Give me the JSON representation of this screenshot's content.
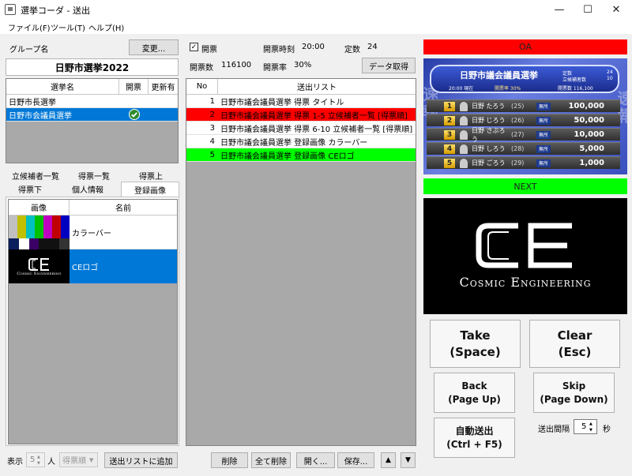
{
  "window": {
    "title": "選挙コーダ - 送出",
    "minimize": "—",
    "maximize": "☐",
    "close": "✕"
  },
  "menu": [
    "ファイル(F)",
    "ツール(T)",
    "ヘルプ(H)"
  ],
  "left": {
    "group_label": "グループ名",
    "change_button": "変更...",
    "group_name": "日野市選挙2022",
    "election_table": {
      "headers": [
        "選挙名",
        "開票",
        "更新有"
      ],
      "rows": [
        {
          "name": "日野市長選挙",
          "checked": false
        },
        {
          "name": "日野市会議員選挙",
          "checked": true
        }
      ]
    },
    "tabs_row1": [
      "立候補者一覧",
      "得票一覧",
      "得票上"
    ],
    "tabs_row2": [
      "得票下",
      "個人情報",
      "登録画像"
    ],
    "image_table": {
      "headers": [
        "画像",
        "名前"
      ],
      "rows": [
        {
          "name": "カラーバー"
        },
        {
          "name": "CEロゴ"
        }
      ]
    },
    "display_label": "表示",
    "display_count": "5",
    "person_unit": "人",
    "sort_select": "得票順",
    "add_button": "送出リストに追加"
  },
  "middle": {
    "open_checkbox_label": "開票",
    "open_time_label": "開票時刻",
    "open_time_value": "20:00",
    "seats_label": "定数",
    "seats_value": "24",
    "votes_label": "開票数",
    "votes_value": "116100",
    "rate_label": "開票率",
    "rate_value": "30%",
    "fetch_button": "データ取得",
    "list_headers": [
      "No",
      "送出リスト"
    ],
    "list_rows": [
      {
        "no": "1",
        "text": "日野市議会議員選挙 得票 タイトル",
        "state": "normal"
      },
      {
        "no": "2",
        "text": "日野市議会議員選挙 得票 1-5 立候補者一覧 [得票順]",
        "state": "oa"
      },
      {
        "no": "3",
        "text": "日野市議会議員選挙 得票 6-10 立候補者一覧 [得票順]",
        "state": "normal"
      },
      {
        "no": "4",
        "text": "日野市議会議員選挙 登録画像 カラーバー",
        "state": "normal"
      },
      {
        "no": "5",
        "text": "日野市議会議員選挙 登録画像 CEロゴ",
        "state": "next"
      }
    ],
    "delete_button": "削除",
    "delete_all_button": "全て削除",
    "open_button": "開く...",
    "save_button": "保存...",
    "up_button": "▲",
    "down_button": "▼"
  },
  "right": {
    "oa_label": "OA",
    "next_label": "NEXT",
    "oa_graphic": {
      "title": "日野市議会議員選挙",
      "seats_label": "定数",
      "seats": "24",
      "candidates_label": "立候補者数",
      "candidates": "10",
      "time": "20:00 現在",
      "rate": "開票率 30%",
      "votes": "開票数 116,100",
      "side_text": "速報",
      "rows": [
        {
          "rank": "1",
          "name": "日野 たろう",
          "age": "(25)",
          "party": "無所",
          "votes": "100,000"
        },
        {
          "rank": "2",
          "name": "日野 じろう",
          "age": "(26)",
          "party": "無所",
          "votes": "50,000"
        },
        {
          "rank": "3",
          "name": "日野 さぶろう",
          "age": "(27)",
          "party": "無所",
          "votes": "10,000"
        },
        {
          "rank": "4",
          "name": "日野 しろう",
          "age": "(28)",
          "party": "無所",
          "votes": "5,000"
        },
        {
          "rank": "5",
          "name": "日野 ごろう",
          "age": "(29)",
          "party": "無所",
          "votes": "1,000"
        }
      ]
    },
    "logo_text": "Cosmic Engineering",
    "take": [
      "Take",
      "(Space)"
    ],
    "clear": [
      "Clear",
      "(Esc)"
    ],
    "back": [
      "Back",
      "(Page Up)"
    ],
    "skip": [
      "Skip",
      "(Page Down)"
    ],
    "auto": [
      "自動送出",
      "(Ctrl + F5)"
    ],
    "interval_label": "送出間隔",
    "interval_value": "5",
    "seconds": "秒"
  },
  "colors": {
    "oa": "#ff0000",
    "next": "#00ff00",
    "selected": "#0078d7",
    "accent": "#0078d7"
  }
}
